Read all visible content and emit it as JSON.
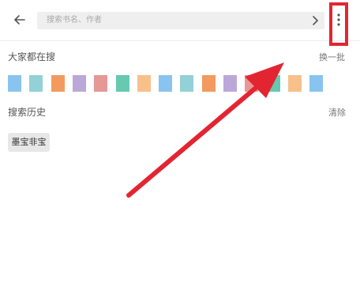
{
  "header": {
    "back_icon": "arrow-left-icon",
    "search_placeholder": "搜索书名、作者",
    "chevron_icon": "chevron-right-icon",
    "more_icon": "more-vertical-icon"
  },
  "hot": {
    "title": "大家都在搜",
    "refresh_label": "换一批",
    "tile_colors": [
      "#89c4f0",
      "#92d1d6",
      "#f39a5f",
      "#bca8d8",
      "#e69896",
      "#66c9b0",
      "#f8c08b",
      "#89c4f0",
      "#92d1d6",
      "#f39a5f",
      "#bca8d8",
      "#e69896",
      "#66c9b0",
      "#f8c08b",
      "#89c4f0"
    ]
  },
  "history": {
    "title": "搜索历史",
    "clear_label": "清除",
    "items": [
      "墨宝非宝"
    ]
  },
  "annotation": {
    "highlight_color": "#e32532",
    "arrow_color": "#e32532"
  }
}
